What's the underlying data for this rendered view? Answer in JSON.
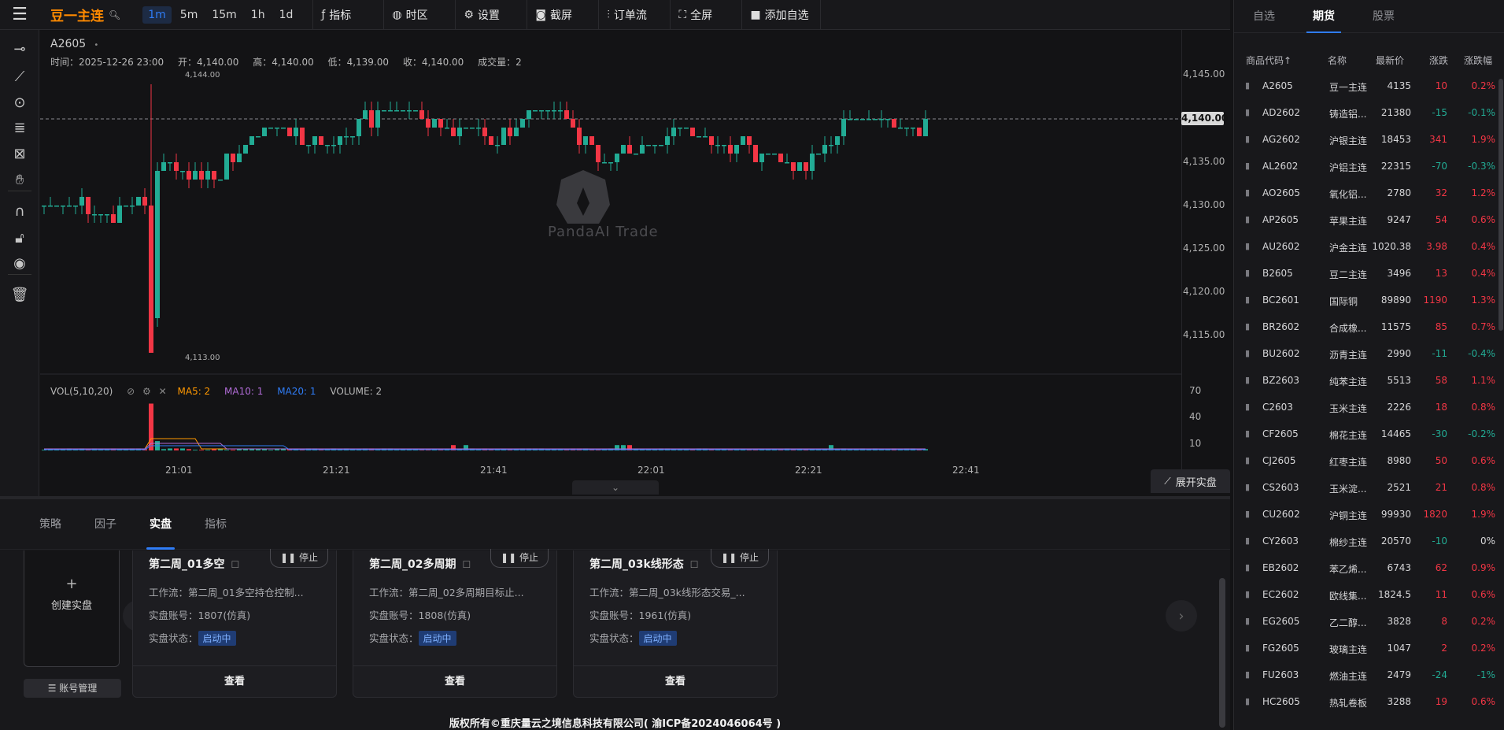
{
  "topbar": {
    "symbol_name": "豆一主连",
    "intervals": [
      "1m",
      "5m",
      "15m",
      "1h",
      "1d"
    ],
    "active_interval": "1m",
    "buttons": [
      "指标",
      "时区",
      "设置",
      "截屏",
      "订单流",
      "全屏",
      "添加自选"
    ]
  },
  "chart": {
    "symbol": "A2605",
    "ohlc": {
      "time_label": "时间：",
      "time": "2025-12-26 23:00",
      "open_label": "开：",
      "open": "4,140.00",
      "high_label": "高：",
      "high": "4,140.00",
      "low_label": "低：",
      "low": "4,139.00",
      "close_label": "收：",
      "close": "4,140.00",
      "vol_label": "成交量：",
      "volume": "2"
    },
    "watermark": "PandaAI Trade",
    "price_ticks": [
      "4,145.00",
      "4,140.00",
      "4,135.00",
      "4,130.00",
      "4,125.00",
      "4,120.00",
      "4,115.00"
    ],
    "current_price": "4,140.00",
    "high_marker": "4,144.00",
    "low_marker": "4,113.00",
    "vol_ticks": [
      "70",
      "40",
      "10"
    ],
    "time_ticks": [
      "21:01",
      "21:21",
      "21:41",
      "22:01",
      "22:21",
      "22:41"
    ],
    "vol_header": {
      "title": "VOL(5,10,20)",
      "ma5": "MA5: 2",
      "ma10": "MA10: 1",
      "ma20": "MA20: 1",
      "volume": "VOLUME: 2"
    },
    "expand_live": "展开实盘",
    "colors": {
      "up": "#f23645",
      "down": "#22ab94",
      "ma5": "#ff9800",
      "ma10": "#b06bd6",
      "ma20": "#2f7cf6"
    }
  },
  "bottom": {
    "tabs": [
      "策略",
      "因子",
      "实盘",
      "指标"
    ],
    "active_tab": "实盘",
    "create_label": "创建实盘",
    "account_mgmt": "账号管理",
    "stop_label": "停止",
    "view_label": "查看",
    "workflow_label": "工作流：",
    "account_label": "实盘账号：",
    "status_label": "实盘状态：",
    "cards": [
      {
        "title": "第二周_01多空",
        "workflow": "第二周_01多空持仓控制...",
        "account": "1807(仿真)",
        "status": "启动中"
      },
      {
        "title": "第二周_02多周期",
        "workflow": "第二周_02多周期目标止...",
        "account": "1808(仿真)",
        "status": "启动中"
      },
      {
        "title": "第二周_03k线形态",
        "workflow": "第二周_03k线形态交易_...",
        "account": "1961(仿真)",
        "status": "启动中"
      }
    ],
    "footer": "版权所有©重庆量云之境信息科技有限公司( 渝ICP备2024046064号 )"
  },
  "watchlist": {
    "tabs": [
      "自选",
      "期货",
      "股票"
    ],
    "active_tab": "期货",
    "headers": [
      "商品代码↑",
      "名称",
      "最新价",
      "涨跌",
      "涨跌幅"
    ],
    "rows": [
      {
        "code": "A2605",
        "name": "豆一主连",
        "price": "4135",
        "chg": "10",
        "pct": "0.2%",
        "dir": "up"
      },
      {
        "code": "AD2602",
        "name": "铸造铝...",
        "price": "21380",
        "chg": "-15",
        "pct": "-0.1%",
        "dir": "dn"
      },
      {
        "code": "AG2602",
        "name": "沪银主连",
        "price": "18453",
        "chg": "341",
        "pct": "1.9%",
        "dir": "up"
      },
      {
        "code": "AL2602",
        "name": "沪铝主连",
        "price": "22315",
        "chg": "-70",
        "pct": "-0.3%",
        "dir": "dn"
      },
      {
        "code": "AO2605",
        "name": "氧化铝...",
        "price": "2780",
        "chg": "32",
        "pct": "1.2%",
        "dir": "up"
      },
      {
        "code": "AP2605",
        "name": "苹果主连",
        "price": "9247",
        "chg": "54",
        "pct": "0.6%",
        "dir": "up"
      },
      {
        "code": "AU2602",
        "name": "沪金主连",
        "price": "1020.38",
        "chg": "3.98",
        "pct": "0.4%",
        "dir": "up"
      },
      {
        "code": "B2605",
        "name": "豆二主连",
        "price": "3496",
        "chg": "13",
        "pct": "0.4%",
        "dir": "up"
      },
      {
        "code": "BC2601",
        "name": "国际铜",
        "price": "89890",
        "chg": "1190",
        "pct": "1.3%",
        "dir": "up"
      },
      {
        "code": "BR2602",
        "name": "合成橡...",
        "price": "11575",
        "chg": "85",
        "pct": "0.7%",
        "dir": "up"
      },
      {
        "code": "BU2602",
        "name": "沥青主连",
        "price": "2990",
        "chg": "-11",
        "pct": "-0.4%",
        "dir": "dn"
      },
      {
        "code": "BZ2603",
        "name": "纯苯主连",
        "price": "5513",
        "chg": "58",
        "pct": "1.1%",
        "dir": "up"
      },
      {
        "code": "C2603",
        "name": "玉米主连",
        "price": "2226",
        "chg": "18",
        "pct": "0.8%",
        "dir": "up"
      },
      {
        "code": "CF2605",
        "name": "棉花主连",
        "price": "14465",
        "chg": "-30",
        "pct": "-0.2%",
        "dir": "dn"
      },
      {
        "code": "CJ2605",
        "name": "红枣主连",
        "price": "8980",
        "chg": "50",
        "pct": "0.6%",
        "dir": "up"
      },
      {
        "code": "CS2603",
        "name": "玉米淀...",
        "price": "2521",
        "chg": "21",
        "pct": "0.8%",
        "dir": "up"
      },
      {
        "code": "CU2602",
        "name": "沪铜主连",
        "price": "99930",
        "chg": "1820",
        "pct": "1.9%",
        "dir": "up"
      },
      {
        "code": "CY2603",
        "name": "棉纱主连",
        "price": "20570",
        "chg": "-10",
        "pct": "0%",
        "dir": "dnflat"
      },
      {
        "code": "EB2602",
        "name": "苯乙烯...",
        "price": "6743",
        "chg": "62",
        "pct": "0.9%",
        "dir": "up"
      },
      {
        "code": "EC2602",
        "name": "欧线集...",
        "price": "1824.5",
        "chg": "11",
        "pct": "0.6%",
        "dir": "up"
      },
      {
        "code": "EG2605",
        "name": "乙二醇...",
        "price": "3828",
        "chg": "8",
        "pct": "0.2%",
        "dir": "up"
      },
      {
        "code": "FG2605",
        "name": "玻璃主连",
        "price": "1047",
        "chg": "2",
        "pct": "0.2%",
        "dir": "up"
      },
      {
        "code": "FU2603",
        "name": "燃油主连",
        "price": "2479",
        "chg": "-24",
        "pct": "-1%",
        "dir": "dn"
      },
      {
        "code": "HC2605",
        "name": "热轧卷板",
        "price": "3288",
        "chg": "19",
        "pct": "0.6%",
        "dir": "up"
      }
    ]
  }
}
